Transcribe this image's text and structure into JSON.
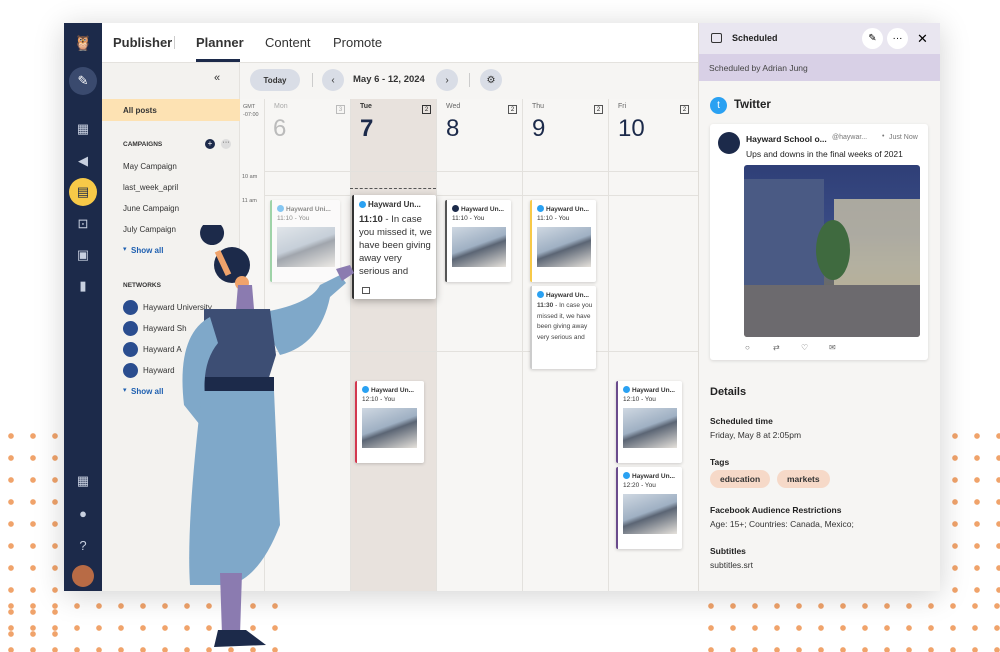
{
  "colors": {
    "accent_orange": "#f0a36b",
    "nav_dark": "#1c2a4a",
    "active_yellow": "#f7c948",
    "twitter_blue": "#2aa1f2"
  },
  "topbar": {
    "app": "Publisher",
    "tabs": [
      "Planner",
      "Content",
      "Promote"
    ]
  },
  "left_panel": {
    "all_posts": "All posts",
    "campaigns_title": "CAMPAIGNS",
    "campaigns": [
      "May Campaign",
      "last_week_april",
      "June Campaign",
      "July Campaign"
    ],
    "show_all": "Show all",
    "networks_title": "NETWORKS",
    "networks": [
      "Hayward University",
      "Hayward Sh",
      "Hayward A",
      "Hayward"
    ],
    "show_all2": "Show all"
  },
  "toolbar": {
    "today": "Today",
    "range": "May 6 - 12, 2024"
  },
  "calendar": {
    "timezone": "GMT -07:00",
    "times": [
      "10 am",
      "11 am"
    ],
    "days": [
      {
        "name": "Mon",
        "num": "6",
        "badge": "3"
      },
      {
        "name": "Tue",
        "num": "7",
        "badge": "2"
      },
      {
        "name": "Wed",
        "num": "8",
        "badge": "2"
      },
      {
        "name": "Thu",
        "num": "9",
        "badge": "2"
      },
      {
        "name": "Fri",
        "num": "10",
        "badge": "2"
      }
    ],
    "posts": {
      "mon": {
        "head": "Hayward Uni...",
        "time": "11:10 - You"
      },
      "tue1": {
        "head": "Hayward Un...",
        "time": "11:10",
        "text": "- In case you missed it, we have been giving away very serious and"
      },
      "tue2": {
        "head": "Hayward Un...",
        "time": "12:10 - You"
      },
      "wed": {
        "head": "Hayward Un...",
        "time": "11:10 - You"
      },
      "thu1": {
        "head": "Hayward Un...",
        "time": "11:10 - You"
      },
      "thu2": {
        "head": "Hayward Un...",
        "time": "11:30",
        "text": "- In case you missed it, we have been giving away very serious and"
      },
      "fri1": {
        "head": "Hayward Un...",
        "time": "12:10 - You"
      },
      "fri2": {
        "head": "Hayward Un...",
        "time": "12:20 - You"
      }
    }
  },
  "right_panel": {
    "header": "Scheduled",
    "scheduled_by": "Scheduled by Adrian Jung",
    "network": "Twitter",
    "tweet": {
      "name": "Hayward School o...",
      "handle": "@haywar...",
      "time": "Just Now",
      "text": "Ups and downs in the final weeks of 2021"
    },
    "details_title": "Details",
    "scheduled_time_label": "Scheduled time",
    "scheduled_time": "Friday, May 8 at 2:05pm",
    "tags_label": "Tags",
    "tags": [
      "education",
      "markets"
    ],
    "fb_label": "Facebook Audience Restrictions",
    "fb_value": "Age: 15+; Countries: Canada, Mexico;",
    "subtitles_label": "Subtitles",
    "subtitles_value": "subtitles.srt"
  }
}
